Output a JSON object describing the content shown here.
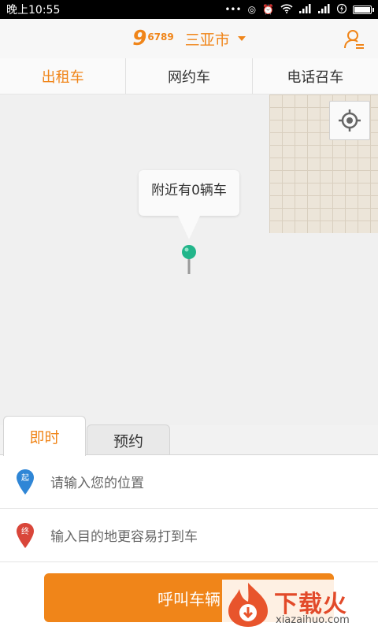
{
  "statusbar": {
    "time": "晚上10:55",
    "battery_level": 1.0
  },
  "header": {
    "logo_nine": "9",
    "logo_digits": "6789",
    "city": "三亚市"
  },
  "tabs": [
    {
      "label": "出租车",
      "active": true
    },
    {
      "label": "网约车",
      "active": false
    },
    {
      "label": "电话召车",
      "active": false
    }
  ],
  "map": {
    "bubble_text": "附近有0辆车"
  },
  "mode_tabs": {
    "now": "即时",
    "book": "预约"
  },
  "fields": {
    "start": {
      "marker": "起",
      "placeholder": "请输入您的位置"
    },
    "end": {
      "marker": "终",
      "placeholder": "输入目的地更容易打到车"
    }
  },
  "call_button": "呼叫车辆",
  "watermark": {
    "title": "下载火",
    "url": "xiazaihuo.com"
  },
  "colors": {
    "accent": "#f08519",
    "start_marker": "#2f86d6",
    "end_marker": "#d9463a",
    "pin": "#22b58a"
  }
}
